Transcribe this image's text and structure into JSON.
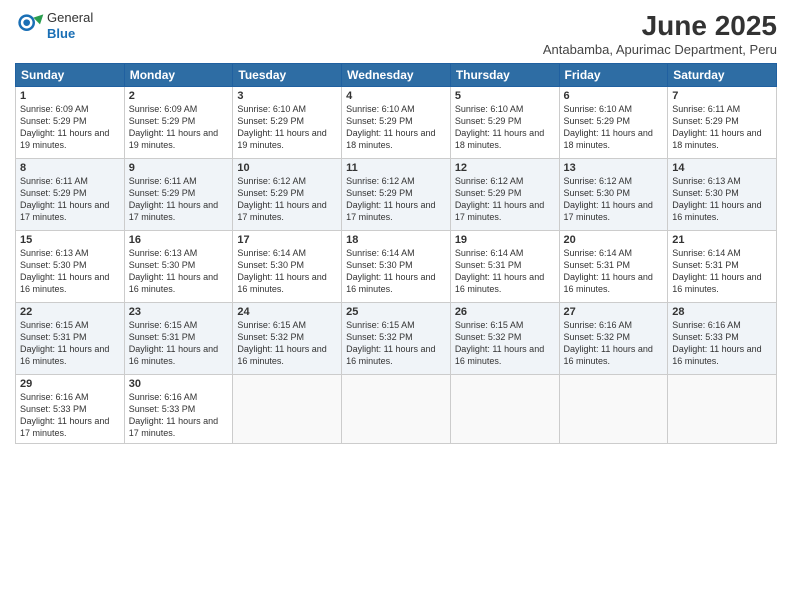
{
  "header": {
    "logo_general": "General",
    "logo_blue": "Blue",
    "month_title": "June 2025",
    "location": "Antabamba, Apurimac Department, Peru"
  },
  "days_of_week": [
    "Sunday",
    "Monday",
    "Tuesday",
    "Wednesday",
    "Thursday",
    "Friday",
    "Saturday"
  ],
  "weeks": [
    [
      {
        "day": "1",
        "sunrise": "6:09 AM",
        "sunset": "5:29 PM",
        "daylight": "11 hours and 19 minutes."
      },
      {
        "day": "2",
        "sunrise": "6:09 AM",
        "sunset": "5:29 PM",
        "daylight": "11 hours and 19 minutes."
      },
      {
        "day": "3",
        "sunrise": "6:10 AM",
        "sunset": "5:29 PM",
        "daylight": "11 hours and 19 minutes."
      },
      {
        "day": "4",
        "sunrise": "6:10 AM",
        "sunset": "5:29 PM",
        "daylight": "11 hours and 18 minutes."
      },
      {
        "day": "5",
        "sunrise": "6:10 AM",
        "sunset": "5:29 PM",
        "daylight": "11 hours and 18 minutes."
      },
      {
        "day": "6",
        "sunrise": "6:10 AM",
        "sunset": "5:29 PM",
        "daylight": "11 hours and 18 minutes."
      },
      {
        "day": "7",
        "sunrise": "6:11 AM",
        "sunset": "5:29 PM",
        "daylight": "11 hours and 18 minutes."
      }
    ],
    [
      {
        "day": "8",
        "sunrise": "6:11 AM",
        "sunset": "5:29 PM",
        "daylight": "11 hours and 17 minutes."
      },
      {
        "day": "9",
        "sunrise": "6:11 AM",
        "sunset": "5:29 PM",
        "daylight": "11 hours and 17 minutes."
      },
      {
        "day": "10",
        "sunrise": "6:12 AM",
        "sunset": "5:29 PM",
        "daylight": "11 hours and 17 minutes."
      },
      {
        "day": "11",
        "sunrise": "6:12 AM",
        "sunset": "5:29 PM",
        "daylight": "11 hours and 17 minutes."
      },
      {
        "day": "12",
        "sunrise": "6:12 AM",
        "sunset": "5:29 PM",
        "daylight": "11 hours and 17 minutes."
      },
      {
        "day": "13",
        "sunrise": "6:12 AM",
        "sunset": "5:30 PM",
        "daylight": "11 hours and 17 minutes."
      },
      {
        "day": "14",
        "sunrise": "6:13 AM",
        "sunset": "5:30 PM",
        "daylight": "11 hours and 16 minutes."
      }
    ],
    [
      {
        "day": "15",
        "sunrise": "6:13 AM",
        "sunset": "5:30 PM",
        "daylight": "11 hours and 16 minutes."
      },
      {
        "day": "16",
        "sunrise": "6:13 AM",
        "sunset": "5:30 PM",
        "daylight": "11 hours and 16 minutes."
      },
      {
        "day": "17",
        "sunrise": "6:14 AM",
        "sunset": "5:30 PM",
        "daylight": "11 hours and 16 minutes."
      },
      {
        "day": "18",
        "sunrise": "6:14 AM",
        "sunset": "5:30 PM",
        "daylight": "11 hours and 16 minutes."
      },
      {
        "day": "19",
        "sunrise": "6:14 AM",
        "sunset": "5:31 PM",
        "daylight": "11 hours and 16 minutes."
      },
      {
        "day": "20",
        "sunrise": "6:14 AM",
        "sunset": "5:31 PM",
        "daylight": "11 hours and 16 minutes."
      },
      {
        "day": "21",
        "sunrise": "6:14 AM",
        "sunset": "5:31 PM",
        "daylight": "11 hours and 16 minutes."
      }
    ],
    [
      {
        "day": "22",
        "sunrise": "6:15 AM",
        "sunset": "5:31 PM",
        "daylight": "11 hours and 16 minutes."
      },
      {
        "day": "23",
        "sunrise": "6:15 AM",
        "sunset": "5:31 PM",
        "daylight": "11 hours and 16 minutes."
      },
      {
        "day": "24",
        "sunrise": "6:15 AM",
        "sunset": "5:32 PM",
        "daylight": "11 hours and 16 minutes."
      },
      {
        "day": "25",
        "sunrise": "6:15 AM",
        "sunset": "5:32 PM",
        "daylight": "11 hours and 16 minutes."
      },
      {
        "day": "26",
        "sunrise": "6:15 AM",
        "sunset": "5:32 PM",
        "daylight": "11 hours and 16 minutes."
      },
      {
        "day": "27",
        "sunrise": "6:16 AM",
        "sunset": "5:32 PM",
        "daylight": "11 hours and 16 minutes."
      },
      {
        "day": "28",
        "sunrise": "6:16 AM",
        "sunset": "5:33 PM",
        "daylight": "11 hours and 16 minutes."
      }
    ],
    [
      {
        "day": "29",
        "sunrise": "6:16 AM",
        "sunset": "5:33 PM",
        "daylight": "11 hours and 17 minutes."
      },
      {
        "day": "30",
        "sunrise": "6:16 AM",
        "sunset": "5:33 PM",
        "daylight": "11 hours and 17 minutes."
      },
      null,
      null,
      null,
      null,
      null
    ]
  ],
  "labels": {
    "sunrise_prefix": "Sunrise: ",
    "sunset_prefix": "Sunset: ",
    "daylight_prefix": "Daylight: "
  }
}
